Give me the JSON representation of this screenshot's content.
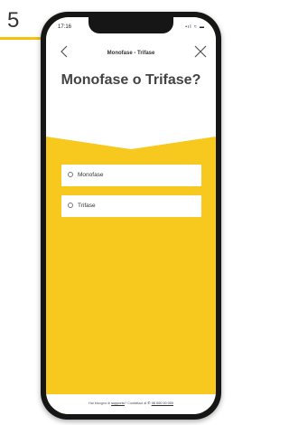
{
  "step": {
    "number": "5"
  },
  "status_bar": {
    "time": "17:16",
    "icons": "•ıl ≈ ▬"
  },
  "header": {
    "title": "Monofase - Trifase"
  },
  "question": {
    "text": "Monofase o Trifase?"
  },
  "options": [
    {
      "label": "Monofase",
      "selected": false
    },
    {
      "label": "Trifase",
      "selected": false
    }
  ],
  "footer": {
    "prefix": "Hai bisogno di",
    "link": "supporto",
    "middle": "? Contattaci al",
    "phone": "06 000 00 000"
  },
  "colors": {
    "accent": "#f7c81e",
    "step_underline": "#f4c20d"
  },
  "icons": {
    "back": "chevron-left-icon",
    "close": "close-icon",
    "phone": "phone-icon"
  }
}
